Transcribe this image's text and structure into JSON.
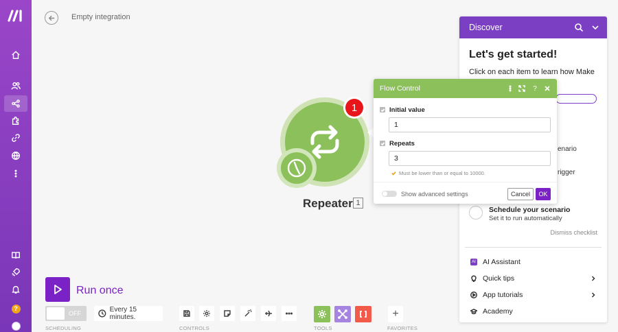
{
  "scenario": {
    "title": "Empty integration"
  },
  "module": {
    "name": "Repeater",
    "id": "1",
    "operations_badge": "1",
    "color": "#8cc05a"
  },
  "toolbar": {
    "run_label": "Run once",
    "toggle_label": "OFF",
    "schedule_label": "Every 15 minutes.",
    "sections": {
      "scheduling": "SCHEDULING",
      "controls": "CONTROLS",
      "tools": "TOOLS",
      "favorites": "FAVORITES"
    },
    "add_favorite": "+"
  },
  "discover": {
    "header": "Discover",
    "title": "Let's get started!",
    "subtitle": "Click on each item to learn how Make",
    "fragments": {
      "a": "enario",
      "b": "rigger"
    },
    "schedule_item": {
      "title": "Schedule your scenario",
      "subtitle": "Set it to run automatically"
    },
    "dismiss": "Dismiss checklist",
    "menu": [
      {
        "label": "AI Assistant",
        "badge": "AI"
      },
      {
        "label": "Quick tips"
      },
      {
        "label": "App tutorials"
      },
      {
        "label": "Academy"
      }
    ]
  },
  "flow_control": {
    "title": "Flow Control",
    "fields": [
      {
        "label": "Initial value",
        "value": "1"
      },
      {
        "label": "Repeats",
        "value": "3"
      }
    ],
    "hint": "Must be lower than or equal to 10000.",
    "advanced_label": "Show advanced settings",
    "cancel_label": "Cancel",
    "ok_label": "OK",
    "help_label": "?"
  },
  "colors": {
    "brand": "#7a22c6",
    "sidebar": "#8a3fc0",
    "badge_red": "#e8161b",
    "module_green": "#8cc05a"
  }
}
